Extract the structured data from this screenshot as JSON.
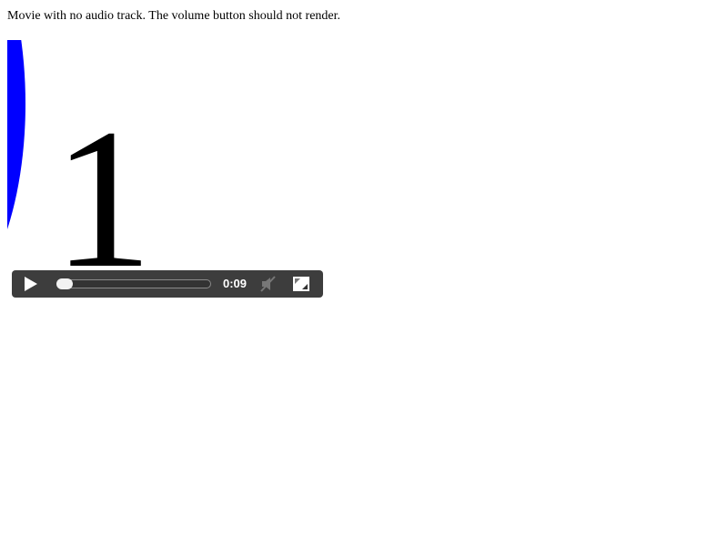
{
  "page": {
    "caption": "Movie with no audio track. The volume button should not render."
  },
  "video": {
    "frame_number": "1",
    "current_time": "0:09",
    "progress": 0.0,
    "has_audio": false,
    "icons": {
      "play": "play-icon",
      "mute": "volume-muted-icon",
      "fullscreen": "fullscreen-icon"
    },
    "colors": {
      "circle": "#0000ff",
      "controls_background": "#282828",
      "controls_text": "#ffffff"
    }
  }
}
